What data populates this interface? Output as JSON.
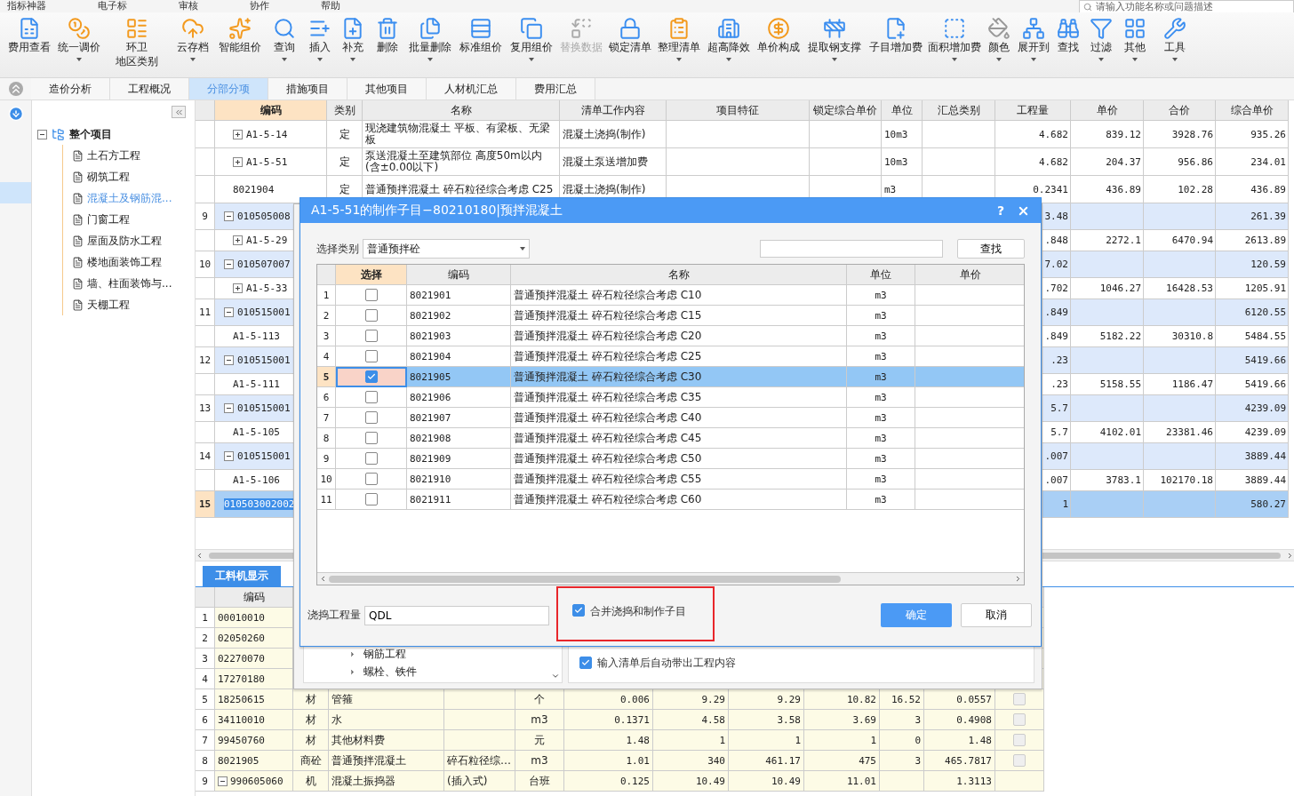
{
  "menu": [
    "指标神器",
    "电子标",
    "审核",
    "协作",
    "帮助"
  ],
  "search": {
    "placeholder": "请输入功能名称或问题描述"
  },
  "toolbar": [
    {
      "label": "费用查看",
      "dropdown": false,
      "disabled": false
    },
    {
      "label": "统一调价",
      "dropdown": true,
      "disabled": false
    },
    {
      "label": "环卫",
      "label_line_2": "地区类别",
      "dropdown": false,
      "disabled": false
    },
    {
      "label": "云存档",
      "dropdown": true,
      "disabled": false
    },
    {
      "label": "智能组价",
      "dropdown": false,
      "disabled": false
    },
    {
      "label": "查询",
      "dropdown": true,
      "disabled": false
    },
    {
      "label": "插入",
      "dropdown": true,
      "disabled": false
    },
    {
      "label": "补充",
      "dropdown": true,
      "disabled": false
    },
    {
      "label": "删除",
      "dropdown": false,
      "disabled": false
    },
    {
      "label": "批量删除",
      "dropdown": true,
      "disabled": false
    },
    {
      "label": "标准组价",
      "dropdown": false,
      "disabled": false
    },
    {
      "label": "复用组价",
      "dropdown": true,
      "disabled": false
    },
    {
      "label": "替换数据",
      "dropdown": false,
      "disabled": true
    },
    {
      "label": "锁定清单",
      "dropdown": false,
      "disabled": false
    },
    {
      "label": "整理清单",
      "dropdown": true,
      "disabled": false
    },
    {
      "label": "超高降效",
      "dropdown": true,
      "disabled": false
    },
    {
      "label": "单价构成",
      "dropdown": false,
      "disabled": false
    },
    {
      "label": "提取钢支撑",
      "dropdown": true,
      "disabled": false
    },
    {
      "label": "子目增加费",
      "dropdown": false,
      "disabled": false
    },
    {
      "label": "面积增加费",
      "dropdown": true,
      "disabled": false
    },
    {
      "label": "颜色",
      "dropdown": true,
      "disabled": false
    },
    {
      "label": "展开到",
      "dropdown": true,
      "disabled": false
    },
    {
      "label": "查找",
      "dropdown": false,
      "disabled": false
    },
    {
      "label": "过滤",
      "dropdown": true,
      "disabled": false
    },
    {
      "label": "其他",
      "dropdown": true,
      "disabled": false
    },
    {
      "label": "工具",
      "dropdown": true,
      "disabled": false
    }
  ],
  "tabs": [
    {
      "label": "造价分析",
      "selected": false
    },
    {
      "label": "工程概况",
      "selected": false
    },
    {
      "label": "分部分项",
      "selected": true
    },
    {
      "label": "措施项目",
      "selected": false
    },
    {
      "label": "其他项目",
      "selected": false
    },
    {
      "label": "人材机汇总",
      "selected": false
    },
    {
      "label": "费用汇总",
      "selected": false
    }
  ],
  "tree": {
    "label": "整个项目",
    "expanded": true,
    "children": [
      {
        "label": "土石方工程",
        "selected": false
      },
      {
        "label": "砌筑工程",
        "selected": false
      },
      {
        "label": "混凝土及钢筋混...",
        "selected": true
      },
      {
        "label": "门窗工程",
        "selected": false
      },
      {
        "label": "屋面及防水工程",
        "selected": false
      },
      {
        "label": "楼地面装饰工程",
        "selected": false
      },
      {
        "label": "墙、柱面装饰与...",
        "selected": false
      },
      {
        "label": "天棚工程",
        "selected": false
      }
    ]
  },
  "main_table": {
    "columns": [
      "编码",
      "类别",
      "名称",
      "清单工作内容",
      "项目特征",
      "锁定综合单价",
      "单位",
      "汇总类别",
      "工程量",
      "单价",
      "合价",
      "综合单价"
    ],
    "rows": [
      {
        "kind": "child",
        "selected": false,
        "has_children": true,
        "expanded": false,
        "code": "A1-5-14",
        "type": "定",
        "name": "现浇建筑物混凝土 平板、有梁板、无梁板",
        "content": "混凝土浇捣(制作)",
        "unit": "10m3",
        "quantity": "4.682",
        "price": "839.12",
        "total": "3928.76",
        "unit_total": "935.26"
      },
      {
        "kind": "child",
        "selected": false,
        "has_children": true,
        "expanded": false,
        "code": "A1-5-51",
        "type": "定",
        "name": "泵送混凝土至建筑部位 高度50m以内(含±0.00以下)",
        "content": "混凝土泵送增加费",
        "unit": "10m3",
        "quantity": "4.682",
        "price": "204.37",
        "total": "956.86",
        "unit_total": "234.01"
      },
      {
        "kind": "child",
        "selected": false,
        "has_children": false,
        "code": "8021904",
        "type": "定",
        "name": "普通预拌混凝土 碎石粒径综合考虑 C25",
        "content": "混凝土浇捣(制作)",
        "unit": "m3",
        "quantity": "0.2341",
        "price": "436.89",
        "total": "102.28",
        "unit_total": "436.89"
      },
      {
        "kind": "parent",
        "selected": false,
        "number": "9",
        "has_children": true,
        "expanded": true,
        "code": "010505008",
        "quantity": "3.48",
        "unit_total": "261.39"
      },
      {
        "kind": "child",
        "selected": false,
        "has_children": true,
        "expanded": false,
        "code": "A1-5-29",
        "quantity": ".848",
        "price": "2272.1",
        "total": "6470.94",
        "unit_total": "2613.89"
      },
      {
        "kind": "parent",
        "selected": false,
        "number": "10",
        "has_children": true,
        "expanded": true,
        "code": "010507007",
        "quantity": "7.02",
        "unit_total": "120.59"
      },
      {
        "kind": "child",
        "selected": false,
        "has_children": true,
        "expanded": false,
        "code": "A1-5-33",
        "quantity": ".702",
        "price": "1046.27",
        "total": "16428.53",
        "unit_total": "1205.91"
      },
      {
        "kind": "parent",
        "selected": false,
        "number": "11",
        "has_children": true,
        "expanded": true,
        "code": "010515001",
        "quantity": ".849",
        "unit_total": "6120.55"
      },
      {
        "kind": "child",
        "selected": false,
        "has_children": false,
        "code": "A1-5-113",
        "quantity": ".849",
        "price": "5182.22",
        "total": "30310.8",
        "unit_total": "5484.55"
      },
      {
        "kind": "parent",
        "selected": false,
        "number": "12",
        "has_children": true,
        "expanded": true,
        "code": "010515001",
        "quantity": ".23",
        "unit_total": "5419.66"
      },
      {
        "kind": "child",
        "selected": false,
        "has_children": false,
        "code": "A1-5-111",
        "quantity": ".23",
        "price": "5158.55",
        "total": "1186.47",
        "unit_total": "5419.66"
      },
      {
        "kind": "parent",
        "selected": false,
        "number": "13",
        "has_children": true,
        "expanded": true,
        "code": "010515001",
        "quantity": "5.7",
        "unit_total": "4239.09"
      },
      {
        "kind": "child",
        "selected": false,
        "has_children": false,
        "code": "A1-5-105",
        "quantity": "5.7",
        "price": "4102.01",
        "total": "23381.46",
        "unit_total": "4239.09"
      },
      {
        "kind": "parent",
        "selected": false,
        "number": "14",
        "has_children": true,
        "expanded": true,
        "code": "010515001",
        "quantity": ".007",
        "unit_total": "3889.44"
      },
      {
        "kind": "child",
        "selected": false,
        "has_children": false,
        "code": "A1-5-106",
        "quantity": ".007",
        "price": "3783.1",
        "total": "102170.18",
        "unit_total": "3889.44"
      },
      {
        "kind": "parent",
        "selected": true,
        "number": "15",
        "has_children": false,
        "code": "010503002002",
        "quantity": "1",
        "unit_total": "580.27"
      }
    ]
  },
  "bottom": {
    "tab": "工料机显示",
    "columns": [
      "编码"
    ],
    "rows": [
      {
        "number": "1",
        "code": "00010010"
      },
      {
        "number": "2",
        "code": "02050260"
      },
      {
        "number": "3",
        "code": "02270070"
      },
      {
        "number": "4",
        "code": "17270180"
      },
      {
        "number": "5",
        "code": "18250615",
        "type": "材",
        "name": "管箍",
        "unit": "个",
        "column_6": "0.006",
        "column_7": "9.29",
        "column_8": "9.29",
        "column_9": "10.82",
        "column_10": "16.52",
        "column_11": "0.0557",
        "checked": false
      },
      {
        "number": "6",
        "code": "34110010",
        "type": "材",
        "name": "水",
        "unit": "m3",
        "column_6": "0.1371",
        "column_7": "4.58",
        "column_8": "3.58",
        "column_9": "3.69",
        "column_10": "3",
        "column_11": "0.4908",
        "checked": false
      },
      {
        "number": "7",
        "code": "99450760",
        "type": "材",
        "name": "其他材料费",
        "unit": "元",
        "column_6": "1.48",
        "column_7": "1",
        "column_8": "1",
        "column_9": "1",
        "column_10": "0",
        "column_11": "1.48",
        "checked": false
      },
      {
        "number": "8",
        "code": "8021905",
        "type": "商砼",
        "name": "普通预拌混凝土",
        "spec": "碎石粒径综…",
        "unit": "m3",
        "column_6": "1.01",
        "column_7": "340",
        "column_8": "461.17",
        "column_9": "475",
        "column_10": "3",
        "column_11": "465.7817",
        "checked": false
      },
      {
        "number": "9",
        "code": "990605060",
        "has_children": true,
        "expanded": true,
        "type": "机",
        "name": "混凝土振捣器",
        "spec": "(插入式)",
        "unit": "台班",
        "column_6": "0.125",
        "column_7": "10.49",
        "column_8": "10.49",
        "column_9": "11.01",
        "column_11": "1.3113"
      }
    ]
  },
  "back_dialog": {
    "tree_items": [
      "钢筋工程",
      "螺栓、铁件"
    ],
    "option": {
      "label": "输入清单后自动带出工程内容",
      "checked": true
    }
  },
  "dialog": {
    "title": "A1-5-51的制作子目−80210180|预拌混凝土",
    "help": "?",
    "category_label": "选择类别",
    "category": "普通预拌砼",
    "search_button": "查找",
    "columns": [
      "选择",
      "编码",
      "名称",
      "单位",
      "单价"
    ],
    "rows": [
      {
        "number": "1",
        "checked": false,
        "selected": false,
        "code": "8021901",
        "name": "普通预拌混凝土 碎石粒径综合考虑 C10",
        "unit": "m3"
      },
      {
        "number": "2",
        "checked": false,
        "selected": false,
        "code": "8021902",
        "name": "普通预拌混凝土 碎石粒径综合考虑 C15",
        "unit": "m3"
      },
      {
        "number": "3",
        "checked": false,
        "selected": false,
        "code": "8021903",
        "name": "普通预拌混凝土 碎石粒径综合考虑 C20",
        "unit": "m3"
      },
      {
        "number": "4",
        "checked": false,
        "selected": false,
        "code": "8021904",
        "name": "普通预拌混凝土 碎石粒径综合考虑 C25",
        "unit": "m3"
      },
      {
        "number": "5",
        "checked": true,
        "selected": true,
        "code": "8021905",
        "name": "普通预拌混凝土 碎石粒径综合考虑 C30",
        "unit": "m3"
      },
      {
        "number": "6",
        "checked": false,
        "selected": false,
        "code": "8021906",
        "name": "普通预拌混凝土 碎石粒径综合考虑 C35",
        "unit": "m3"
      },
      {
        "number": "7",
        "checked": false,
        "selected": false,
        "code": "8021907",
        "name": "普通预拌混凝土 碎石粒径综合考虑 C40",
        "unit": "m3"
      },
      {
        "number": "8",
        "checked": false,
        "selected": false,
        "code": "8021908",
        "name": "普通预拌混凝土 碎石粒径综合考虑 C45",
        "unit": "m3"
      },
      {
        "number": "9",
        "checked": false,
        "selected": false,
        "code": "8021909",
        "name": "普通预拌混凝土 碎石粒径综合考虑 C50",
        "unit": "m3"
      },
      {
        "number": "10",
        "checked": false,
        "selected": false,
        "code": "8021910",
        "name": "普通预拌混凝土 碎石粒径综合考虑 C55",
        "unit": "m3"
      },
      {
        "number": "11",
        "checked": false,
        "selected": false,
        "code": "8021911",
        "name": "普通预拌混凝土 碎石粒径综合考虑 C60",
        "unit": "m3"
      }
    ],
    "quantity_label": "浇捣工程量",
    "quantity": "QDL",
    "merge": {
      "label": "合并浇捣和制作子目",
      "checked": true,
      "highlighted": true
    },
    "ok": "确定",
    "cancel": "取消"
  }
}
